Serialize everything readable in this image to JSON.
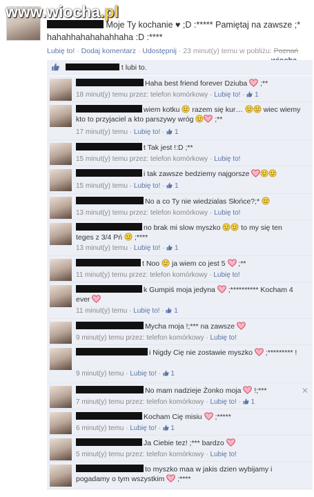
{
  "watermark": {
    "site": "www.wiocha",
    "tld": ".pl"
  },
  "post": {
    "text": "Moje Ty kochanie ♥ ;D :***** Pamiętaj na zawsze ;* hahahhahahahahhaha :D :****",
    "like": "Lubię to!",
    "comment": "Dodaj komentarz",
    "share": "Udostępnij",
    "time": "23 minut(y) temu w pobliżu:",
    "location": "Poznań"
  },
  "logo": "wiocha",
  "likes": {
    "text": "t lubi to."
  },
  "comments": [
    {
      "text": "Haha best friend forever Dziuba",
      "suffix": ";**",
      "meta": "18 minut(y) temu przez: telefon komórkowy",
      "like": "Lubię to!",
      "count": "1"
    },
    {
      "text": "wiem kotku",
      "text2": "razem się kur…",
      "text3": "wiec wiemy kto to przyjaciel a kto parszywy wróg",
      "suffix": ";**",
      "meta": "17 minut(y) temu",
      "like": "Lubię to!",
      "count": "1"
    },
    {
      "text": "t Tak jest !:D ;**",
      "meta": "15 minut(y) temu przez: telefon komórkowy",
      "like": "Lubię to!"
    },
    {
      "text": "i tak zawsze bedziemy najgorsze",
      "meta": "15 minut(y) temu",
      "like": "Lubię to!",
      "count": "1"
    },
    {
      "text": "No a co Ty nie wiedzialas Słońce?;*",
      "meta": "13 minut(y) temu przez: telefon komórkowy",
      "like": "Lubię to!"
    },
    {
      "text": "no brak mi slow myszko",
      "text2": "to my się ten teges z 3/4 Pń",
      "suffix": ";****",
      "meta": "13 minut(y) temu",
      "like": "Lubię to!",
      "count": "1"
    },
    {
      "text": "t Noo",
      "text2": "ja wiem co jest 5",
      "suffix": ";**",
      "meta": "11 minut(y) temu przez: telefon komórkowy",
      "like": "Lubię to!"
    },
    {
      "text": "k Gumpiś moja jedyna",
      "text2": ";********** Kocham 4 ever",
      "meta": "11 minut(y) temu",
      "like": "Lubię to!",
      "count": "1"
    },
    {
      "text": "Mycha moja !;*** na zawsze",
      "meta": "9 minut(y) temu przez: telefon komórkowy",
      "like": "Lubię to!"
    },
    {
      "text": "i Nigdy Cię nie zostawie myszko",
      "text2": ";********* !",
      "meta": "9 minut(y) temu",
      "like": "Lubię to!",
      "count": "1"
    },
    {
      "text": "No mam nadzieje Żonko moja",
      "suffix": "!;***",
      "meta": "7 minut(y) temu przez: telefon komórkowy",
      "like": "Lubię to!",
      "count": "1",
      "close": "✕"
    },
    {
      "text": "Kocham Cię misiu",
      "suffix": ";*****",
      "meta": "6 minut(y) temu",
      "like": "Lubię to!",
      "count": "1"
    },
    {
      "text": "Ja Ciebie tez! ;*** bardzo",
      "meta": "5 minut(y) temu przez: telefon komórkowy",
      "like": "Lubię to!"
    },
    {
      "text": "to myszko maa w jakis dzien wybijamy i pogadamy o tym wszystkim",
      "suffix": ";****",
      "meta": ""
    }
  ]
}
